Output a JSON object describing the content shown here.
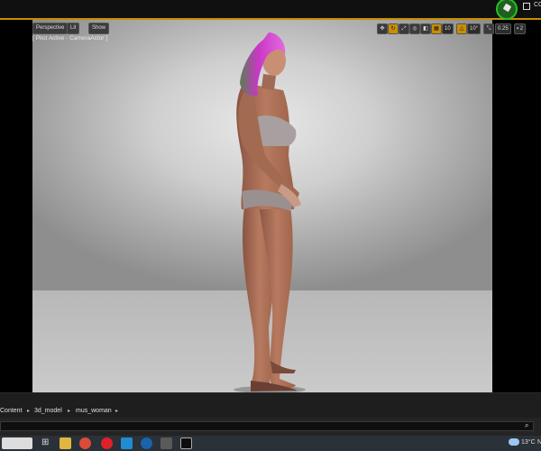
{
  "topbar": {
    "right_text": "CC"
  },
  "viewport": {
    "perspective_label": "Perspective",
    "lit_label": "Lit",
    "show_label": "Show",
    "pilot_text": "[ Pilot Active - CameraActor ]",
    "grid_snap": "10",
    "rotation_snap": "10°",
    "scale_snap": "0.25",
    "camera_speed": "2"
  },
  "content_browser": {
    "breadcrumbs": [
      "Content",
      "3d_model",
      "mus_woman"
    ]
  },
  "taskbar": {
    "temperature": "13°C",
    "extra": "N",
    "apps": [
      "file-explorer",
      "chrome",
      "opera",
      "malwarebytes",
      "ccleaner",
      "notes",
      "unreal-engine"
    ]
  },
  "colors": {
    "accent": "#c98e00",
    "hair": "#d63fd0",
    "skin": "#b07058"
  }
}
